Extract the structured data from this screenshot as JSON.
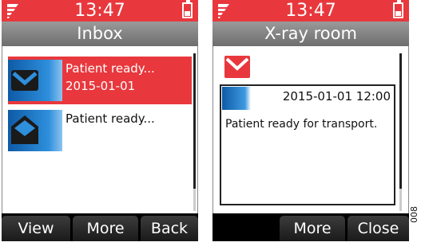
{
  "colors": {
    "status_red": "#e8383d",
    "title_grey": "#7f7f7f",
    "icon_blue": "#2e8fdc",
    "softkey_black": "#000000"
  },
  "screens": [
    {
      "status": {
        "time": "13:47"
      },
      "title": "Inbox",
      "list": [
        {
          "line1": "Patient ready...",
          "line2": "2015-01-01",
          "selected": true,
          "icon": "envelope-closed-icon"
        },
        {
          "line1": "Patient ready...",
          "line2": "",
          "selected": false,
          "icon": "envelope-open-icon"
        }
      ],
      "softkeys": [
        "View",
        "More",
        "Back"
      ]
    },
    {
      "status": {
        "time": "13:47"
      },
      "title": "X-ray room",
      "message": {
        "date": "2015-01-01",
        "time": "12:00",
        "datetime": "2015-01-01  12:00",
        "body": "Patient ready for transport."
      },
      "softkeys": [
        "",
        "More",
        "Close"
      ]
    }
  ],
  "side_label": "008"
}
